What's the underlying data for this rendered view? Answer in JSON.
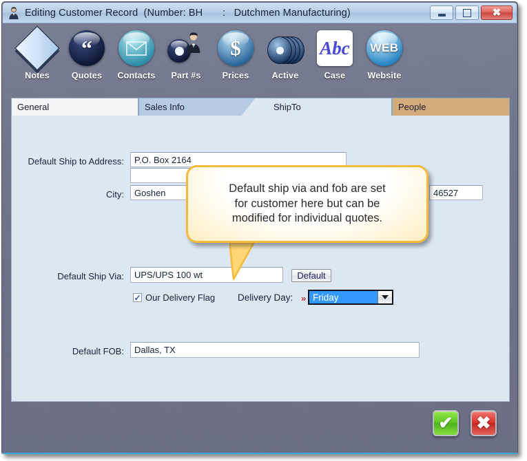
{
  "window": {
    "title": "Editing Customer Record  (Number: BH       :   Dutchmen Manufacturing)",
    "app_icon": "user-record-icon",
    "controls": {
      "minimize": "Minimize",
      "maximize": "Maximize",
      "close": "Close"
    }
  },
  "toolbar": {
    "items": [
      {
        "label": "Notes",
        "icon": "notes-book-icon"
      },
      {
        "label": "Quotes",
        "icon": "quote-marks-icon"
      },
      {
        "label": "Contacts",
        "icon": "envelope-icon"
      },
      {
        "label": "Part #s",
        "icon": "person-disc-icon"
      },
      {
        "label": "Prices",
        "icon": "dollar-sign-icon"
      },
      {
        "label": "Active",
        "icon": "disc-stack-icon"
      },
      {
        "label": "Case",
        "icon": "abc-case-icon"
      },
      {
        "label": "Website",
        "icon": "web-globe-icon"
      }
    ]
  },
  "tabs": [
    {
      "label": "General",
      "active": false
    },
    {
      "label": "Sales Info",
      "active": false
    },
    {
      "label": "ShipTo",
      "active": true
    },
    {
      "label": "People",
      "active": false
    }
  ],
  "form": {
    "ship_to_address_label": "Default Ship to Address:",
    "address_line1": "P.O. Box 2164",
    "address_line2": "",
    "city_label": "City:",
    "city": "Goshen",
    "zip": "46527",
    "ship_via_label": "Default Ship Via:",
    "ship_via": "UPS/UPS 100 wt",
    "default_button": "Default",
    "delivery_flag_label": "Our Delivery Flag",
    "delivery_flag_checked": true,
    "delivery_day_label": "Delivery Day:",
    "delivery_day_marker": "»",
    "delivery_day_value": "Friday",
    "fob_label": "Default FOB:",
    "fob": "Dallas, TX"
  },
  "callout": {
    "text": "Default ship via and fob are set\nfor customer here but can be\nmodified for individual quotes.",
    "border_color": "#f5b93c"
  },
  "actions": {
    "ok_label": "✔",
    "cancel_label": "✖"
  },
  "colors": {
    "panel_bg": "#dce7f2",
    "frame": "#6f7389",
    "title_bar": "#b6cde6",
    "tab_people": "#d4ac7c",
    "tab_sales": "#b5cbe4",
    "dropdown_highlight": "#3399ff",
    "ok_green": "#63c728",
    "cancel_red": "#d8382f"
  }
}
